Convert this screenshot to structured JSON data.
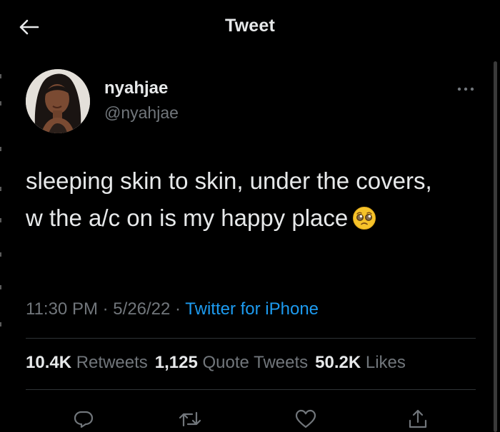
{
  "header": {
    "title": "Tweet",
    "back_icon": "arrow-left-icon"
  },
  "author": {
    "display_name": "nyahjae",
    "handle": "@nyahjae",
    "avatar_icon": "avatar-photo"
  },
  "tweet": {
    "text": "sleeping skin to skin, under the covers, w the a/c on is my happy place",
    "emoji_icon": "pleading-face-emoji",
    "time": "11:30 PM",
    "date": "5/26/22",
    "separator": "·",
    "source": "Twitter for iPhone"
  },
  "stats": {
    "retweets_count": "10.4K",
    "retweets_label": "Retweets",
    "quotes_count": "1,125",
    "quotes_label": "Quote Tweets",
    "likes_count": "50.2K",
    "likes_label": "Likes"
  },
  "actions": [
    "reply-icon",
    "retweet-icon",
    "like-icon",
    "share-icon"
  ],
  "colors": {
    "background": "#000000",
    "text": "#e7e9ea",
    "secondary": "#71767b",
    "accent": "#1d9bf0",
    "divider": "#2f3336"
  }
}
